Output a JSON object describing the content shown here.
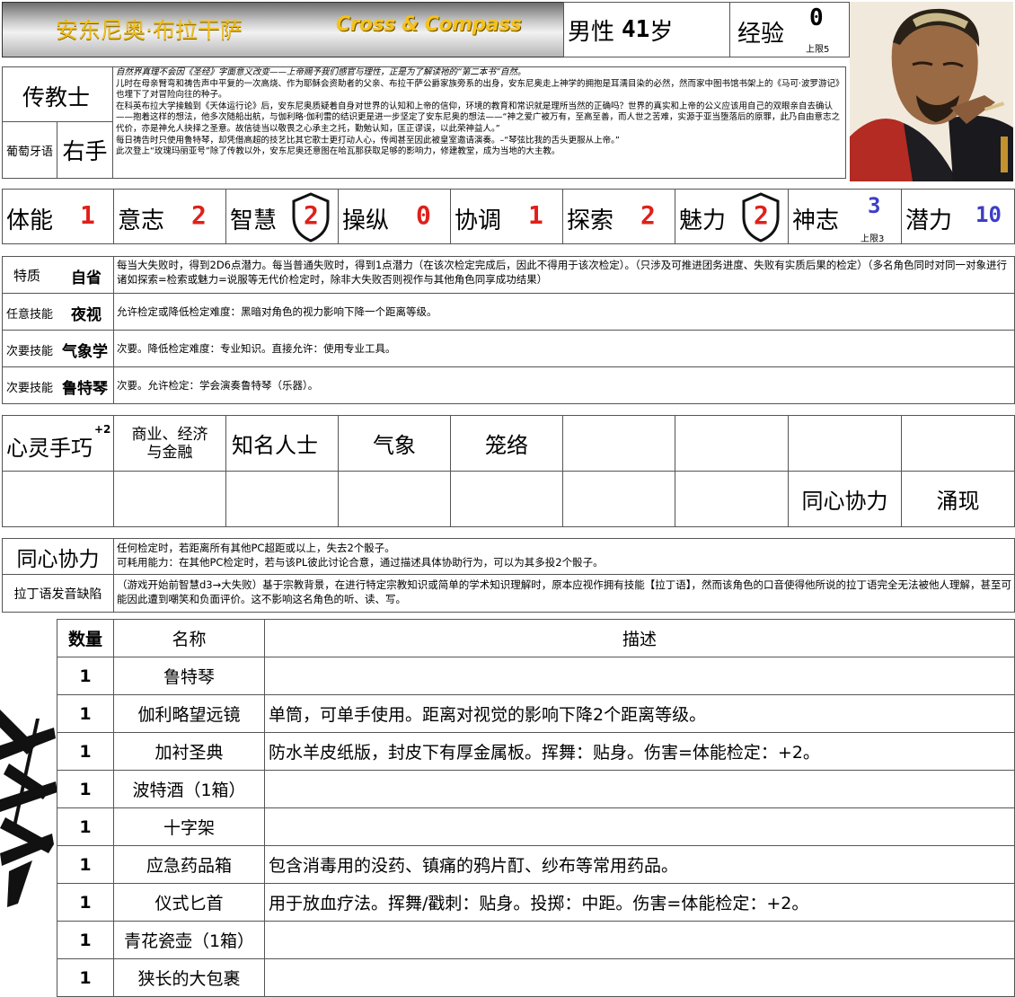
{
  "header": {
    "name": "安东尼奥·布拉干萨",
    "brand": "Cross & Compass",
    "gender_label": "男性",
    "age": "41",
    "age_unit": "岁",
    "exp_label": "经验",
    "exp_value": "0",
    "exp_cap": "上限5"
  },
  "profile": {
    "occupation": "传教士",
    "language": "葡萄牙语",
    "handedness": "右手",
    "bio": [
      "自然界真理不会因《圣经》字面意义改变——上帝赐予我们感官与理性，正是为了解读祂的“第二本书”自然。",
      "儿时在母亲臂弯和祷告声中平复的一次高烧、作为耶稣会资助者的父亲、布拉干萨公爵家族旁系的出身，安东尼奥走上神学的拥抱是耳濡目染的必然，然而家中图书馆书架上的《马可·波罗游记》也埋下了对冒险向往的种子。",
      "在科英布拉大学接触到《天体运行论》后，安东尼奥质疑着自身对世界的认知和上帝的信仰，环境的教育和常识就是理所当然的正确吗？世界的真实和上帝的公义应该用自己的双眼亲自去确认——抱着这样的想法，他多次随船出航，与伽利略·伽利雷的结识更是进一步坚定了安东尼奥的想法——“神之爱广被万有，至高至善，而人世之苦难，实源于亚当堕落后的原罪，此乃自由意志之代价，亦是神允人抉择之圣意。故信徒当以敬畏之心承主之托，勤勉认知，匡正谬误，以此荣神益人。”",
      "每日祷告时只使用鲁特琴，却凭借高超的技艺比其它歌士更打动人心，传闻甚至因此被皇室邀请演奏。–“琴弦比我的舌头更服从上帝。”",
      "此次登上“玫瑰玛丽亚号”除了传教以外，安东尼奥还意图在哈瓦那获取足够的影响力，修建教堂，成为当地的大主教。"
    ]
  },
  "attributes": [
    {
      "label": "体能",
      "value": "1",
      "color": "red",
      "shield": false
    },
    {
      "label": "意志",
      "value": "2",
      "color": "red",
      "shield": false
    },
    {
      "label": "智慧",
      "value": "2",
      "color": "red",
      "shield": true
    },
    {
      "label": "操纵",
      "value": "0",
      "color": "red",
      "shield": false
    },
    {
      "label": "协调",
      "value": "1",
      "color": "red",
      "shield": false
    },
    {
      "label": "探索",
      "value": "2",
      "color": "red",
      "shield": false
    },
    {
      "label": "魅力",
      "value": "2",
      "color": "red",
      "shield": true
    },
    {
      "label": "神志",
      "value": "3",
      "color": "blue",
      "cap": "上限3",
      "shield": false
    },
    {
      "label": "潜力",
      "value": "10",
      "color": "blue",
      "shield": false
    }
  ],
  "skills": [
    {
      "type": "特质",
      "name": "自省",
      "desc": "每当大失败时，得到2D6点潜力。每当普通失败时，得到1点潜力（在该次检定完成后，因此不得用于该次检定）。（只涉及可推进团务进度、失败有实质后果的检定）（多名角色同时对同一对象进行诸如探索=检索或魅力=说服等无代价检定时，除非大失败否则视作与其他角色同享成功结果）"
    },
    {
      "type": "任意技能",
      "name": "夜视",
      "desc": "允许检定或降低检定难度：黑暗对角色的视力影响下降一个距离等级。"
    },
    {
      "type": "次要技能",
      "name": "气象学",
      "desc": "次要。降低检定难度：专业知识。直接允许：使用专业工具。"
    },
    {
      "type": "次要技能",
      "name": "鲁特琴",
      "desc": "次要。允许检定：学会演奏鲁特琴（乐器）。"
    }
  ],
  "specialties": {
    "row1": [
      "心灵手巧",
      "商业、经济\n与金融",
      "知名人士",
      "气象",
      "笼络",
      "",
      "",
      "",
      ""
    ],
    "row1_badge": "+2",
    "row2": [
      "",
      "",
      "",
      "",
      "",
      "",
      "",
      "同心协力",
      "涌现"
    ]
  },
  "abilities": [
    {
      "name": "同心协力",
      "desc": "任何检定时，若距离所有其他PC超距或以上，失去2个骰子。\n可耗用能力：在其他PC检定时，若与该PL彼此讨论合意，通过描述具体协助行为，可以为其多投2个骰子。"
    },
    {
      "name": "拉丁语发音缺陷",
      "desc": "（游戏开始前智慧d3→大失败）基于宗教背景，在进行特定宗教知识或简单的学术知识理解时，原本应视作拥有技能【拉丁语】，然而该角色的口音使得他所说的拉丁语完全无法被他人理解，甚至可能因此遭到嘲笑和负面评价。这不影响这名角色的听、读、写。"
    }
  ],
  "inventory": {
    "headers": {
      "qty": "数量",
      "name": "名称",
      "desc": "描述"
    },
    "rows": [
      {
        "qty": "1",
        "name": "鲁特琴",
        "desc": ""
      },
      {
        "qty": "1",
        "name": "伽利略望远镜",
        "desc": "单筒，可单手使用。距离对视觉的影响下降2个距离等级。"
      },
      {
        "qty": "1",
        "name": "加衬圣典",
        "desc": "防水羊皮纸版，封皮下有厚金属板。挥舞：贴身。伤害=体能检定：+2。"
      },
      {
        "qty": "1",
        "name": "波特酒（1箱）",
        "desc": ""
      },
      {
        "qty": "1",
        "name": "十字架",
        "desc": ""
      },
      {
        "qty": "1",
        "name": "应急药品箱",
        "desc": "包含消毒用的没药、镇痛的鸦片酊、纱布等常用药品。"
      },
      {
        "qty": "1",
        "name": "仪式匕首",
        "desc": "用于放血疗法。挥舞/戳刺：贴身。投掷：中距。伤害=体能检定：+2。"
      },
      {
        "qty": "1",
        "name": "青花瓷壶（1箱）",
        "desc": ""
      },
      {
        "qty": "1",
        "name": "狭长的大包裹",
        "desc": ""
      }
    ]
  },
  "colors": {
    "red": "#e0201a",
    "blue": "#3d3dc8",
    "gold": "#f0c020"
  },
  "icons": {
    "shield": "shield-icon",
    "portrait": "character-portrait"
  }
}
